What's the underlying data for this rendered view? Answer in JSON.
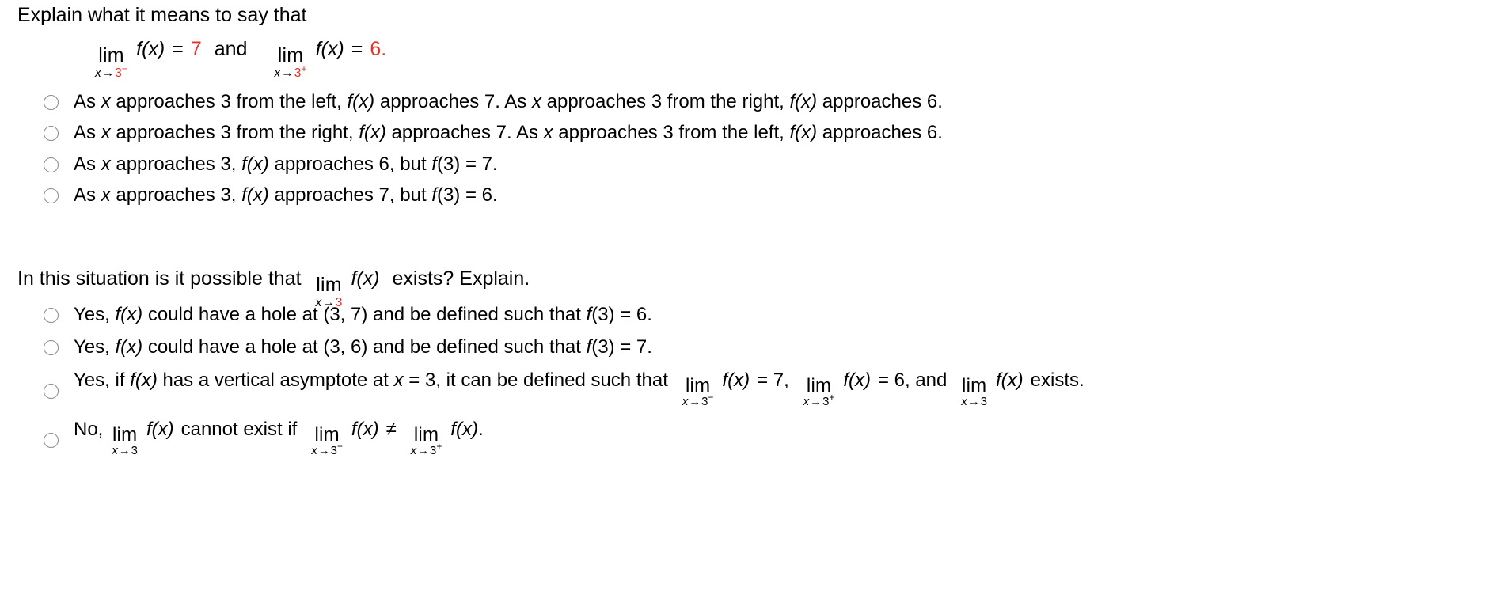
{
  "colors": {
    "accent_red": "#e8302a",
    "text": "#000000",
    "radio_border": "#8a8a8a",
    "background": "#ffffff"
  },
  "question1": {
    "prompt": "Explain what it means to say that",
    "formula": {
      "limit_left": {
        "operator": "lim",
        "subscript_var": "x",
        "arrow": "→",
        "approach_value": "3",
        "side": "−",
        "function": "f(x)",
        "equals": "=",
        "value": "7"
      },
      "conjunction": "and",
      "limit_right": {
        "operator": "lim",
        "subscript_var": "x",
        "arrow": "→",
        "approach_value": "3",
        "side": "+",
        "function": "f(x)",
        "equals": "=",
        "value": "6",
        "period": "."
      }
    },
    "options": [
      {
        "id": "q1-opt-1",
        "selected": false,
        "parts": [
          {
            "t": "As ",
            "s": "plain"
          },
          {
            "t": "x",
            "s": "italic"
          },
          {
            "t": " approaches 3 from the left, ",
            "s": "plain"
          },
          {
            "t": "f(x)",
            "s": "italic"
          },
          {
            "t": " approaches 7. As ",
            "s": "plain"
          },
          {
            "t": "x",
            "s": "italic"
          },
          {
            "t": " approaches 3 from the right, ",
            "s": "plain"
          },
          {
            "t": "f(x)",
            "s": "italic"
          },
          {
            "t": " approaches 6.",
            "s": "plain"
          }
        ]
      },
      {
        "id": "q1-opt-2",
        "selected": false,
        "parts": [
          {
            "t": "As ",
            "s": "plain"
          },
          {
            "t": "x",
            "s": "italic"
          },
          {
            "t": " approaches 3 from the right, ",
            "s": "plain"
          },
          {
            "t": "f(x)",
            "s": "italic"
          },
          {
            "t": " approaches 7. As ",
            "s": "plain"
          },
          {
            "t": "x",
            "s": "italic"
          },
          {
            "t": " approaches 3 from the left, ",
            "s": "plain"
          },
          {
            "t": "f(x)",
            "s": "italic"
          },
          {
            "t": " approaches 6.",
            "s": "plain"
          }
        ]
      },
      {
        "id": "q1-opt-3",
        "selected": false,
        "parts": [
          {
            "t": "As ",
            "s": "plain"
          },
          {
            "t": "x",
            "s": "italic"
          },
          {
            "t": " approaches 3, ",
            "s": "plain"
          },
          {
            "t": "f(x)",
            "s": "italic"
          },
          {
            "t": " approaches 6, but ",
            "s": "plain"
          },
          {
            "t": "f",
            "s": "italic"
          },
          {
            "t": "(3) = 7.",
            "s": "plain"
          }
        ]
      },
      {
        "id": "q1-opt-4",
        "selected": false,
        "parts": [
          {
            "t": "As ",
            "s": "plain"
          },
          {
            "t": "x",
            "s": "italic"
          },
          {
            "t": " approaches 3, ",
            "s": "plain"
          },
          {
            "t": "f(x)",
            "s": "italic"
          },
          {
            "t": " approaches 7, but ",
            "s": "plain"
          },
          {
            "t": "f",
            "s": "italic"
          },
          {
            "t": "(3) = 6.",
            "s": "plain"
          }
        ]
      }
    ]
  },
  "question2": {
    "prompt_before": "In this situation is it possible that",
    "limit": {
      "operator": "lim",
      "subscript_var": "x",
      "arrow": "→",
      "approach_value": "3",
      "function": "f(x)"
    },
    "prompt_after": "exists? Explain.",
    "options": [
      {
        "id": "q2-opt-1",
        "selected": false,
        "parts": [
          {
            "t": "Yes, ",
            "s": "plain"
          },
          {
            "t": "f(x)",
            "s": "italic"
          },
          {
            "t": " could have a hole at (3, 7) and be defined such that ",
            "s": "plain"
          },
          {
            "t": "f",
            "s": "italic"
          },
          {
            "t": "(3) = 6.",
            "s": "plain"
          }
        ]
      },
      {
        "id": "q2-opt-2",
        "selected": false,
        "parts": [
          {
            "t": "Yes, ",
            "s": "plain"
          },
          {
            "t": "f(x)",
            "s": "italic"
          },
          {
            "t": " could have a hole at (3, 6) and be defined such that ",
            "s": "plain"
          },
          {
            "t": "f",
            "s": "italic"
          },
          {
            "t": "(3) = 7.",
            "s": "plain"
          }
        ]
      },
      {
        "id": "q2-opt-3",
        "selected": false,
        "lead_text_1": "Yes, if ",
        "lead_math_1": "f(x)",
        "lead_text_2": " has a vertical asymptote at ",
        "lead_math_2": "x",
        "lead_text_3": " = 3, it can be defined such that",
        "limit_a": {
          "operator": "lim",
          "subscript_var": "x",
          "arrow": "→",
          "approach_value": "3",
          "side": "−",
          "function": "f(x)",
          "equals_value": "= 7,"
        },
        "limit_b": {
          "operator": "lim",
          "subscript_var": "x",
          "arrow": "→",
          "approach_value": "3",
          "side": "+",
          "function": "f(x)",
          "equals_value": "= 6, and"
        },
        "limit_c": {
          "operator": "lim",
          "subscript_var": "x",
          "arrow": "→",
          "approach_value": "3",
          "function": "f(x)"
        },
        "tail_text": "exists."
      },
      {
        "id": "q2-opt-4",
        "selected": false,
        "lead_text_1": "No,",
        "limit_a": {
          "operator": "lim",
          "subscript_var": "x",
          "arrow": "→",
          "approach_value": "3",
          "function": "f(x)"
        },
        "mid_text": "cannot exist if",
        "limit_b": {
          "operator": "lim",
          "subscript_var": "x",
          "arrow": "→",
          "approach_value": "3",
          "side": "−",
          "function": "f(x)"
        },
        "neq": "≠",
        "limit_c": {
          "operator": "lim",
          "subscript_var": "x",
          "arrow": "→",
          "approach_value": "3",
          "side": "+",
          "function": "f(x)",
          "period": "."
        }
      }
    ]
  }
}
